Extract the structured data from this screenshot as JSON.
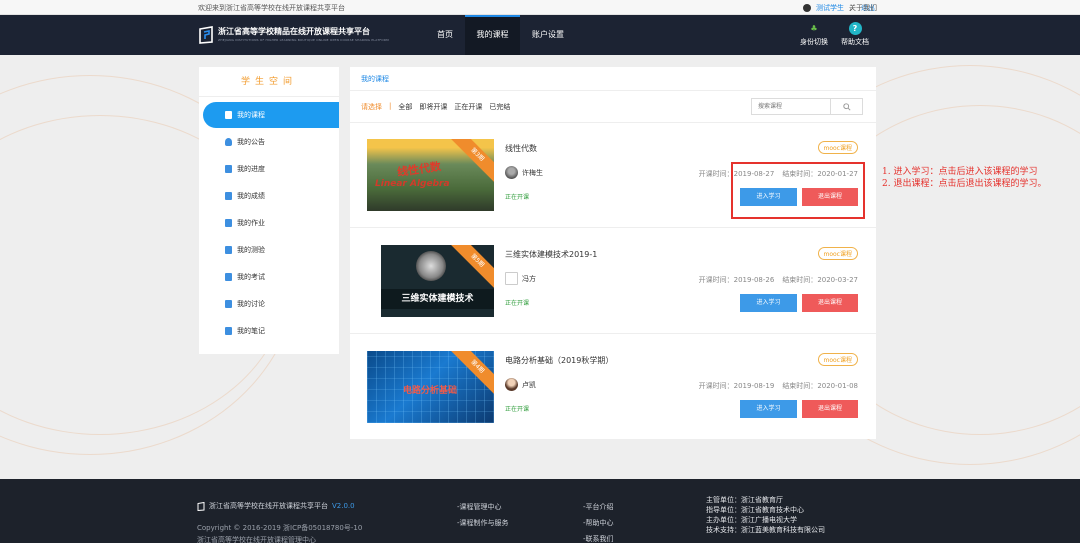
{
  "topbar": {
    "welcome": "欢迎来到浙江省高等学校在线开放课程共享平台",
    "user": "测试学生",
    "logout": "退出",
    "about": "关于我们"
  },
  "header": {
    "logo_cn": "浙江省高等学校精品在线开放课程共享平台",
    "logo_en": "ZHEJIANG INSTITUTIONS OF HIGHER LEARNING BOUTIQUE ONLINE OPEN COURSE SHARING PLATFORM",
    "nav": [
      "首页",
      "我的课程",
      "账户设置"
    ],
    "role_switch": "身份切换",
    "help": "帮助文档"
  },
  "sidebar": {
    "title": "学生空间",
    "items": [
      {
        "label": "我的课程",
        "icon": "book-icon",
        "active": true
      },
      {
        "label": "我的公告",
        "icon": "bell-icon"
      },
      {
        "label": "我的进度",
        "icon": "clipboard-icon"
      },
      {
        "label": "我的成绩",
        "icon": "chart-icon"
      },
      {
        "label": "我的作业",
        "icon": "document-icon"
      },
      {
        "label": "我的测验",
        "icon": "monitor-icon"
      },
      {
        "label": "我的考试",
        "icon": "edit-icon"
      },
      {
        "label": "我的讨论",
        "icon": "chat-icon"
      },
      {
        "label": "我的笔记",
        "icon": "note-icon"
      }
    ]
  },
  "content": {
    "breadcrumb": "我的课程",
    "filter_label": "请选择",
    "filter_sep": "|",
    "filters": [
      "全部",
      "即将开课",
      "正在开课",
      "已完结"
    ],
    "search_placeholder": "搜索课程",
    "start_label": "开课时间：",
    "end_label": "结束时间：",
    "enter_label": "进入学习",
    "quit_label": "退出课程",
    "courses": [
      {
        "title": "线性代数",
        "teacher": "许梅生",
        "start": "2019-08-27",
        "end": "2020-01-27",
        "status": "正在开课",
        "badge": "mooc课程",
        "ribbon": "第3期",
        "cover_text": "线性代数",
        "cover_sub": "Linear Algebra"
      },
      {
        "title": "三维实体建模技术2019-1",
        "teacher": "冯方",
        "start": "2019-08-26",
        "end": "2020-03-27",
        "status": "正在开课",
        "badge": "mooc课程",
        "ribbon": "第5期",
        "cover_text": "三维实体建模技术"
      },
      {
        "title": "电路分析基础（2019秋学期）",
        "teacher": "卢凯",
        "start": "2019-08-19",
        "end": "2020-01-08",
        "status": "正在开课",
        "badge": "mooc课程",
        "ribbon": "第4期",
        "cover_text": "电路分析基础"
      }
    ]
  },
  "annotation": {
    "line1": "1. 进入学习：点击后进入该课程的学习",
    "line2": "2. 退出课程：点击后退出该课程的学习。"
  },
  "footer": {
    "name": "浙江省高等学校在线开放课程共享平台",
    "version": "V2.0.0",
    "copyright": "Copyright © 2016-2019 浙ICP备05018780号-10",
    "copyright2": "浙江省高等学校在线开放课程管理中心",
    "links1": [
      "-课程管理中心",
      "-课程制作与服务"
    ],
    "links2": [
      "-平台介绍",
      "-帮助中心",
      "-联系我们"
    ],
    "info": [
      "主管单位：浙江省教育厅",
      "指导单位：浙江省教育技术中心",
      "主办单位：浙江广播电视大学",
      "技术支持：浙江蓝美教育科技有限公司"
    ]
  },
  "colors": {
    "accent": "#1d9bf0",
    "orange": "#f08c2c",
    "danger": "#ef5a5a",
    "nav_bg": "#1c2333"
  }
}
